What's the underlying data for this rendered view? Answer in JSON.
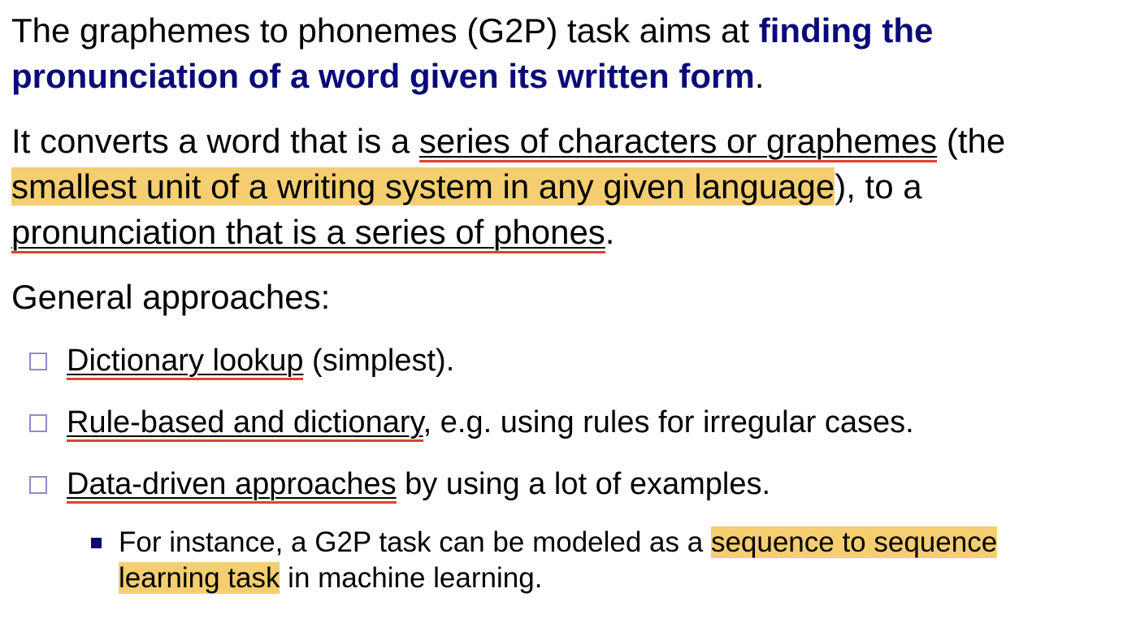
{
  "intro": {
    "before": "The graphemes to phonemes (G2P) task aims at ",
    "emphasis": "finding the pronunciation of a word given its written form",
    "after": "."
  },
  "conversion": {
    "lead": "It converts a word that is a ",
    "underline1": "series of characters or graphemes",
    "mid1": " (the ",
    "highlight": "smallest unit of a writing system in any given language",
    "mid2": "), to a ",
    "underline2": "pronunciation that is a series of phones",
    "end": "."
  },
  "approaches": {
    "heading": "General approaches:",
    "items": [
      {
        "term": "Dictionary lookup",
        "rest": " (simplest)."
      },
      {
        "term": "Rule-based and dictionary",
        "rest": ", e.g. using rules for irregular cases."
      },
      {
        "term": "Data-driven approaches",
        "rest": " by using a lot of examples."
      }
    ],
    "sub": {
      "before": "For instance, a G2P task can be modeled as a ",
      "highlight": "sequence to sequence learning task",
      "after": " in machine learning."
    }
  },
  "colors": {
    "emphasis": "#0a0a7a",
    "underline": "#e0412e",
    "highlight": "#f4ce70",
    "checkbox_border": "#8c8cc8"
  }
}
